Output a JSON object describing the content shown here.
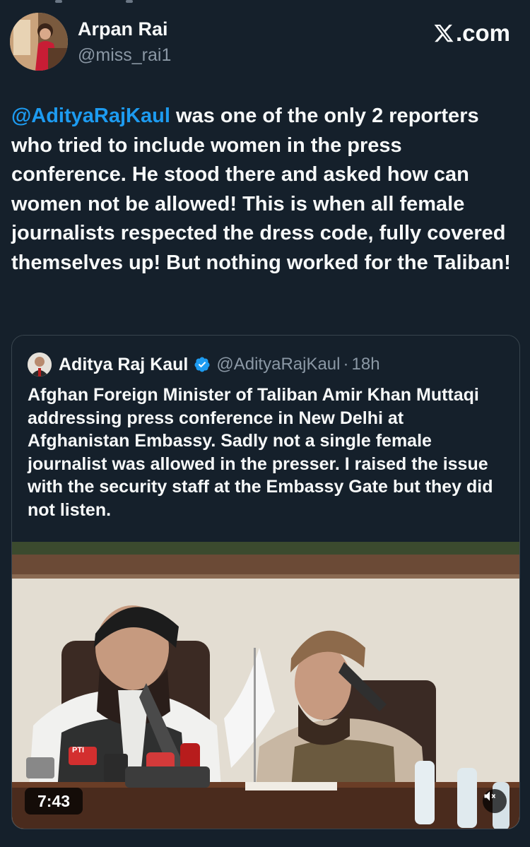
{
  "brand": {
    "label": ".com",
    "icon": "x-logo-icon"
  },
  "author": {
    "display_name": "Arpan Rai",
    "handle": "@miss_rai1",
    "avatar_icon": "profile-photo"
  },
  "tweet": {
    "mention": "@AdityaRajKaul",
    "text": " was one of the only 2 reporters who tried to include women in the press conference. He stood there and asked how can women not be allowed! This is when all female journalists respected the dress code, fully covered themselves up! But nothing worked for the Taliban!"
  },
  "quoted": {
    "display_name": "Aditya Raj Kaul",
    "verified_icon": "verified-badge-icon",
    "handle": "@AdityaRajKaul",
    "separator": "·",
    "time": "18h",
    "text": "Afghan Foreign Minister of Taliban Amir Khan Muttaqi addressing press conference in New Delhi at Afghanistan Embassy. Sadly not a single female journalist was allowed in the presser. I raised the issue with the security staff at the Embassy Gate but they did not listen.",
    "video": {
      "duration": "7:43",
      "mute_icon": "speaker-muted-icon",
      "mic_label": "PTI"
    }
  },
  "colors": {
    "background": "#15202b",
    "text": "#f7f9f9",
    "muted": "#8b98a5",
    "accent": "#1d9bf0",
    "border": "#38444d"
  }
}
